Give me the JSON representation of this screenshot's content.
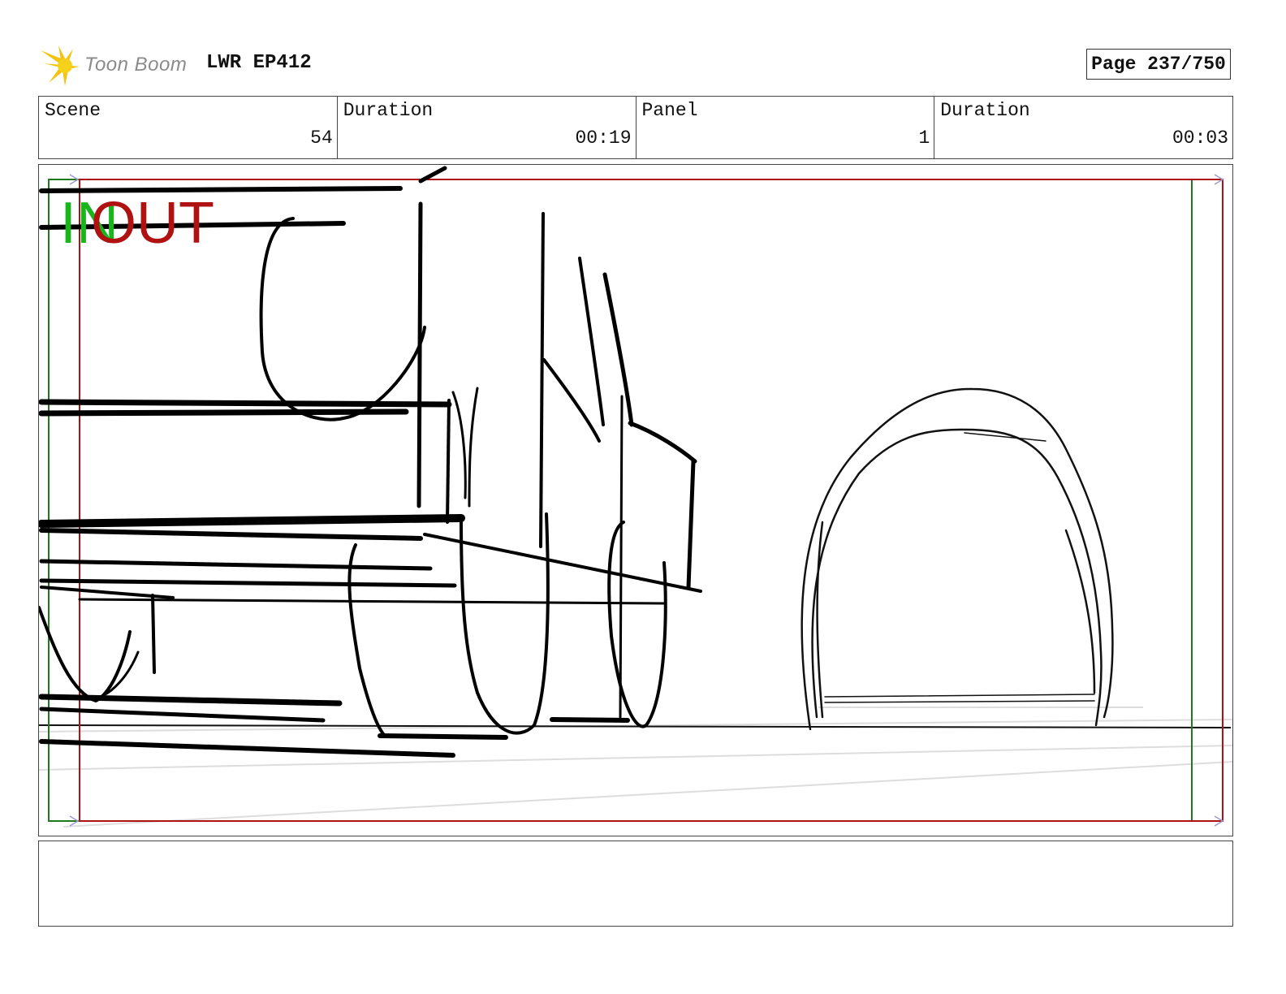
{
  "header": {
    "brand": "Toon Boom",
    "project": "LWR EP412",
    "page": "Page 237/750"
  },
  "info": [
    {
      "label": "Scene",
      "value": "54"
    },
    {
      "label": "Duration",
      "value": "00:19"
    },
    {
      "label": "Panel",
      "value": "1"
    },
    {
      "label": "Duration",
      "value": "00:03"
    }
  ],
  "panel": {
    "in_marker": "IN",
    "out_marker": "OUT"
  },
  "notes": {
    "text": ""
  },
  "colors": {
    "in_frame": "#1f7a1f",
    "out_frame": "#b01212",
    "logo": "#f2c40f",
    "ink": "#000000"
  }
}
